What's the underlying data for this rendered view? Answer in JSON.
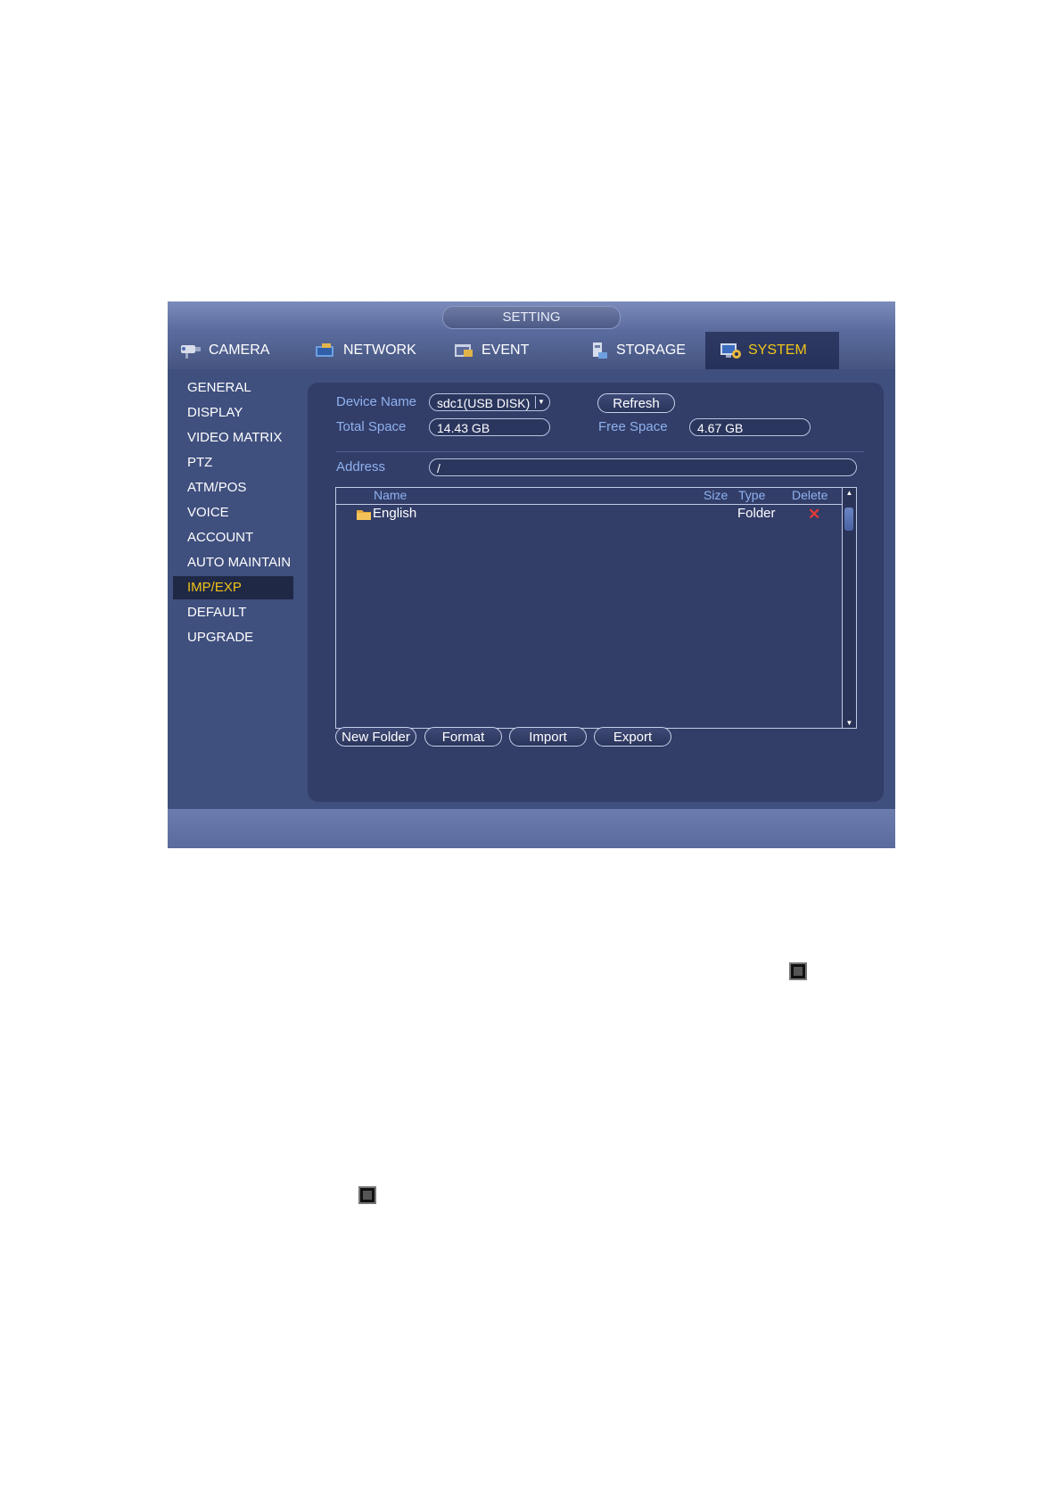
{
  "window": {
    "title": "SETTING"
  },
  "tabs": [
    {
      "label": "CAMERA",
      "icon": "camera-icon"
    },
    {
      "label": "NETWORK",
      "icon": "network-icon"
    },
    {
      "label": "EVENT",
      "icon": "event-icon"
    },
    {
      "label": "STORAGE",
      "icon": "storage-icon"
    },
    {
      "label": "SYSTEM",
      "icon": "system-icon",
      "active": true
    }
  ],
  "sidebar": {
    "items": [
      {
        "label": "GENERAL"
      },
      {
        "label": "DISPLAY"
      },
      {
        "label": "VIDEO MATRIX"
      },
      {
        "label": "PTZ"
      },
      {
        "label": "ATM/POS"
      },
      {
        "label": "VOICE"
      },
      {
        "label": "ACCOUNT"
      },
      {
        "label": "AUTO MAINTAIN"
      },
      {
        "label": "IMP/EXP",
        "active": true
      },
      {
        "label": "DEFAULT"
      },
      {
        "label": "UPGRADE"
      }
    ]
  },
  "form": {
    "device_name_label": "Device Name",
    "device_name_value": "sdc1(USB DISK)",
    "refresh_label": "Refresh",
    "total_space_label": "Total Space",
    "total_space_value": "14.43 GB",
    "free_space_label": "Free Space",
    "free_space_value": "4.67 GB",
    "address_label": "Address",
    "address_value": "/"
  },
  "filelist": {
    "columns": {
      "name": "Name",
      "size": "Size",
      "type": "Type",
      "delete": "Delete"
    },
    "rows": [
      {
        "name": "English",
        "size": "",
        "type": "Folder",
        "delete_icon": "delete-x-icon"
      }
    ]
  },
  "buttons": {
    "new_folder": "New Folder",
    "format": "Format",
    "import": "Import",
    "export": "Export"
  },
  "colors": {
    "accent": "#f0c419",
    "panel": "#323d68",
    "label": "#8fb2ef",
    "delete": "#e53935"
  }
}
